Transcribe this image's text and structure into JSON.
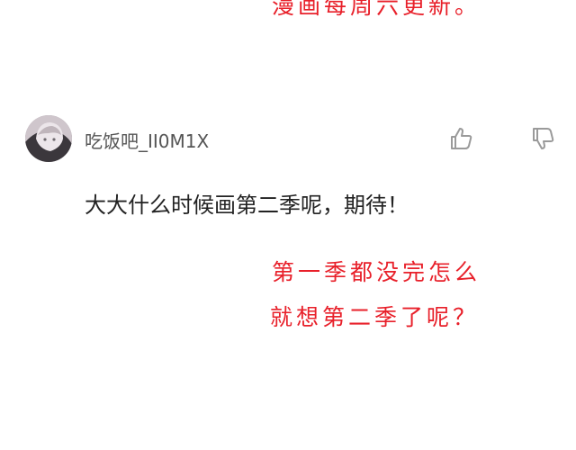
{
  "top_note": "漫画每周六更新。",
  "comment": {
    "username": "吃饭吧_II0M1X",
    "text": "大大什么时候画第二季呢，期待！",
    "avatar": "avatar-image",
    "like_icon": "thumbs-up-icon",
    "dislike_icon": "thumbs-down-icon"
  },
  "author_reply": {
    "line1": "第一季都没完怎么",
    "line2": "就想第二季了呢？"
  },
  "colors": {
    "handwriting": "#e8202a",
    "username": "#555555",
    "comment_text": "#222222",
    "icon": "#9a9a9a"
  }
}
